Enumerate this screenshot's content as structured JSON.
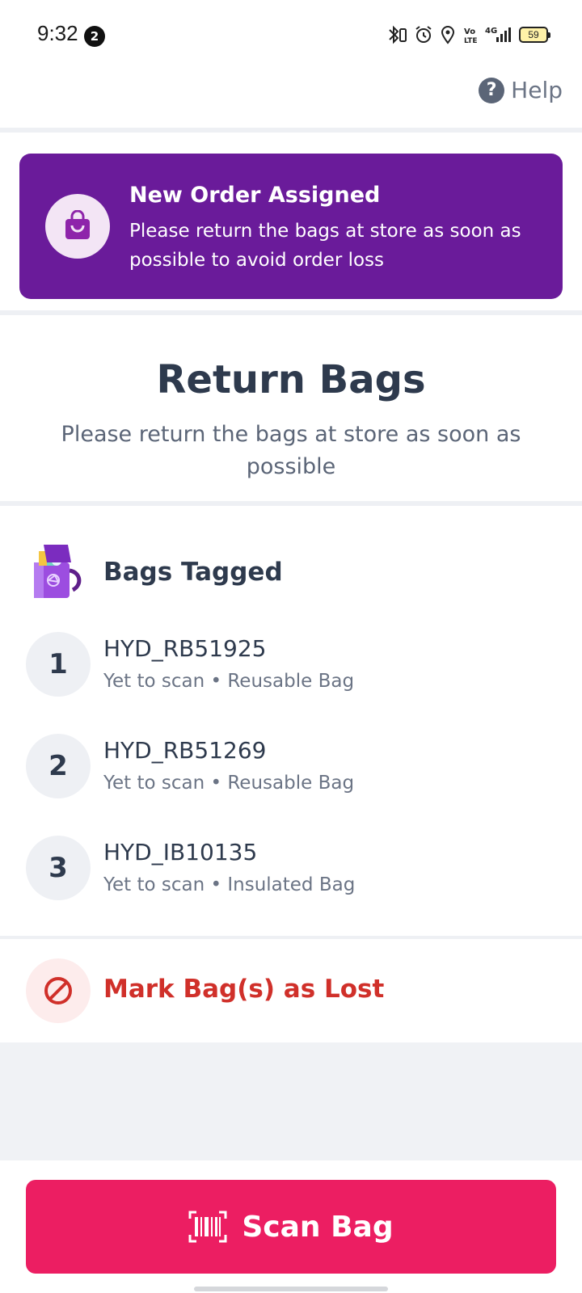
{
  "status_bar": {
    "time": "9:32",
    "notification_count": "2",
    "battery_level": "59",
    "network": "4G"
  },
  "header": {
    "help_label": "Help",
    "help_icon_glyph": "?"
  },
  "banner": {
    "title": "New Order Assigned",
    "message": "Please return the bags at store as soon as possible to avoid order loss",
    "icon": "shopping-bag-icon",
    "background": "#6a1b9a"
  },
  "return_section": {
    "title": "Return Bags",
    "subtitle": "Please return the bags at store as soon as possible"
  },
  "bags": {
    "header": "Bags Tagged",
    "items": [
      {
        "index": "1",
        "id": "HYD_RB51925",
        "meta": "Yet to scan • Reusable Bag"
      },
      {
        "index": "2",
        "id": "HYD_RB51269",
        "meta": "Yet to scan • Reusable Bag"
      },
      {
        "index": "3",
        "id": "HYD_IB10135",
        "meta": "Yet to scan • Insulated Bag"
      }
    ]
  },
  "lost": {
    "label": "Mark Bag(s) as Lost",
    "icon": "prohibited-icon",
    "color": "#d0302a"
  },
  "scan_button": {
    "label": "Scan Bag",
    "icon": "barcode-icon",
    "color": "#ec1e62"
  }
}
